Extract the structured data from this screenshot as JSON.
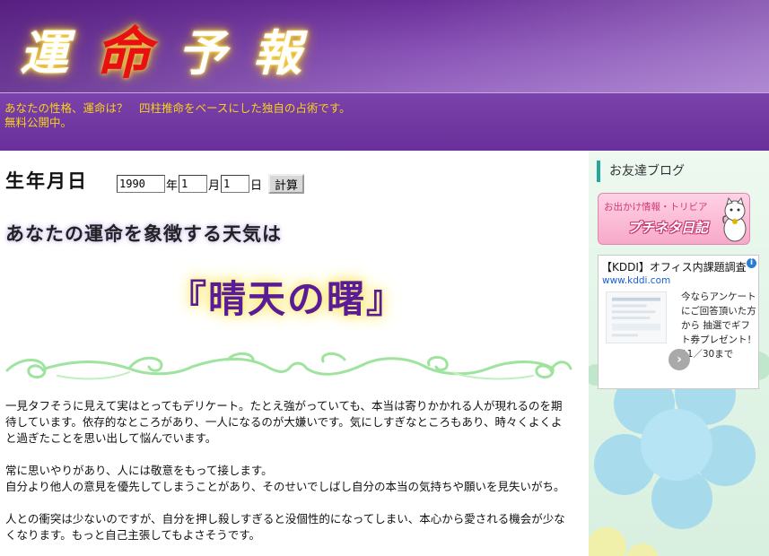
{
  "header": {
    "logo_chars": [
      "運",
      "命",
      "予",
      "報"
    ],
    "tagline_line1": "あなたの性格、運命は？　四柱推命をベースにした独自の占術です。",
    "tagline_line2": "無料公開中。"
  },
  "form": {
    "label": "生年月日",
    "year_value": "1990",
    "year_unit": "年",
    "month_value": "1",
    "month_unit": "月",
    "day_value": "1",
    "day_unit": "日",
    "submit_label": "計算"
  },
  "result": {
    "heading": "あなたの運命を象徴する天気は",
    "weather": "『晴天の曙』",
    "paragraphs": [
      "一見タフそうに見えて実はとってもデリケート。たとえ強がっていても、本当は寄りかかれる人が現れるのを期待しています。依存的なところがあり、一人になるのが大嫌いです。気にしすぎなところもあり、時々くよくよと過ぎたことを思い出して悩んでいます。",
      "常に思いやりがあり、人には敬意をもって接します。\n自分より他人の意見を優先してしまうことがあり、そのせいでしばし自分の本当の気持ちや願いを見失いがち。",
      "人との衝突は少ないのですが、自分を押し殺しすぎると没個性的になってしまい、本心から愛される機会が少なくなります。もっと自己主張してもよさそうです。"
    ]
  },
  "sidebar": {
    "friends_title": "お友達ブログ",
    "banner_small": "お出かけ情報・トリビア",
    "banner_big": "プチネタ日記",
    "ad": {
      "title": "【KDDI】オフィス内課題調査",
      "url": "www.kddi.com",
      "text": "今ならアンケートにご回答頂いた方から 抽選でギフト券プレゼント！ 11／30まで"
    }
  },
  "colors": {
    "header_purple": "#7a42ab",
    "tagline_yellow": "#f6d21a",
    "weather_text": "#5a1c96",
    "ornament_green": "#9ee39e",
    "sidebar_accent": "#22a89c"
  }
}
